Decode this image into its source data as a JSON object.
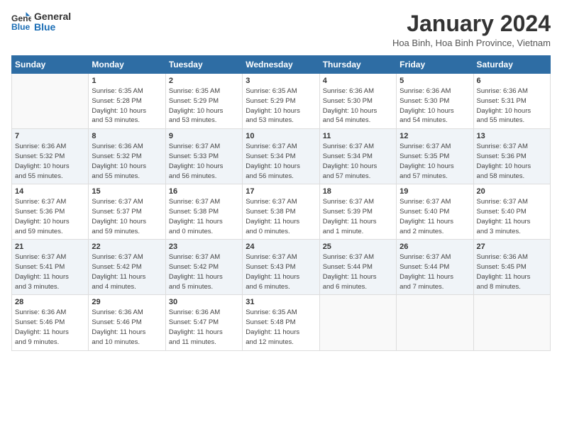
{
  "header": {
    "logo_line1": "General",
    "logo_line2": "Blue",
    "month_title": "January 2024",
    "location": "Hoa Binh, Hoa Binh Province, Vietnam"
  },
  "calendar": {
    "headers": [
      "Sunday",
      "Monday",
      "Tuesday",
      "Wednesday",
      "Thursday",
      "Friday",
      "Saturday"
    ],
    "weeks": [
      [
        {
          "day": "",
          "info": ""
        },
        {
          "day": "1",
          "info": "Sunrise: 6:35 AM\nSunset: 5:28 PM\nDaylight: 10 hours\nand 53 minutes."
        },
        {
          "day": "2",
          "info": "Sunrise: 6:35 AM\nSunset: 5:29 PM\nDaylight: 10 hours\nand 53 minutes."
        },
        {
          "day": "3",
          "info": "Sunrise: 6:35 AM\nSunset: 5:29 PM\nDaylight: 10 hours\nand 53 minutes."
        },
        {
          "day": "4",
          "info": "Sunrise: 6:36 AM\nSunset: 5:30 PM\nDaylight: 10 hours\nand 54 minutes."
        },
        {
          "day": "5",
          "info": "Sunrise: 6:36 AM\nSunset: 5:30 PM\nDaylight: 10 hours\nand 54 minutes."
        },
        {
          "day": "6",
          "info": "Sunrise: 6:36 AM\nSunset: 5:31 PM\nDaylight: 10 hours\nand 55 minutes."
        }
      ],
      [
        {
          "day": "7",
          "info": "Sunrise: 6:36 AM\nSunset: 5:32 PM\nDaylight: 10 hours\nand 55 minutes."
        },
        {
          "day": "8",
          "info": "Sunrise: 6:36 AM\nSunset: 5:32 PM\nDaylight: 10 hours\nand 55 minutes."
        },
        {
          "day": "9",
          "info": "Sunrise: 6:37 AM\nSunset: 5:33 PM\nDaylight: 10 hours\nand 56 minutes."
        },
        {
          "day": "10",
          "info": "Sunrise: 6:37 AM\nSunset: 5:34 PM\nDaylight: 10 hours\nand 56 minutes."
        },
        {
          "day": "11",
          "info": "Sunrise: 6:37 AM\nSunset: 5:34 PM\nDaylight: 10 hours\nand 57 minutes."
        },
        {
          "day": "12",
          "info": "Sunrise: 6:37 AM\nSunset: 5:35 PM\nDaylight: 10 hours\nand 57 minutes."
        },
        {
          "day": "13",
          "info": "Sunrise: 6:37 AM\nSunset: 5:36 PM\nDaylight: 10 hours\nand 58 minutes."
        }
      ],
      [
        {
          "day": "14",
          "info": "Sunrise: 6:37 AM\nSunset: 5:36 PM\nDaylight: 10 hours\nand 59 minutes."
        },
        {
          "day": "15",
          "info": "Sunrise: 6:37 AM\nSunset: 5:37 PM\nDaylight: 10 hours\nand 59 minutes."
        },
        {
          "day": "16",
          "info": "Sunrise: 6:37 AM\nSunset: 5:38 PM\nDaylight: 11 hours\nand 0 minutes."
        },
        {
          "day": "17",
          "info": "Sunrise: 6:37 AM\nSunset: 5:38 PM\nDaylight: 11 hours\nand 0 minutes."
        },
        {
          "day": "18",
          "info": "Sunrise: 6:37 AM\nSunset: 5:39 PM\nDaylight: 11 hours\nand 1 minute."
        },
        {
          "day": "19",
          "info": "Sunrise: 6:37 AM\nSunset: 5:40 PM\nDaylight: 11 hours\nand 2 minutes."
        },
        {
          "day": "20",
          "info": "Sunrise: 6:37 AM\nSunset: 5:40 PM\nDaylight: 11 hours\nand 3 minutes."
        }
      ],
      [
        {
          "day": "21",
          "info": "Sunrise: 6:37 AM\nSunset: 5:41 PM\nDaylight: 11 hours\nand 3 minutes."
        },
        {
          "day": "22",
          "info": "Sunrise: 6:37 AM\nSunset: 5:42 PM\nDaylight: 11 hours\nand 4 minutes."
        },
        {
          "day": "23",
          "info": "Sunrise: 6:37 AM\nSunset: 5:42 PM\nDaylight: 11 hours\nand 5 minutes."
        },
        {
          "day": "24",
          "info": "Sunrise: 6:37 AM\nSunset: 5:43 PM\nDaylight: 11 hours\nand 6 minutes."
        },
        {
          "day": "25",
          "info": "Sunrise: 6:37 AM\nSunset: 5:44 PM\nDaylight: 11 hours\nand 6 minutes."
        },
        {
          "day": "26",
          "info": "Sunrise: 6:37 AM\nSunset: 5:44 PM\nDaylight: 11 hours\nand 7 minutes."
        },
        {
          "day": "27",
          "info": "Sunrise: 6:36 AM\nSunset: 5:45 PM\nDaylight: 11 hours\nand 8 minutes."
        }
      ],
      [
        {
          "day": "28",
          "info": "Sunrise: 6:36 AM\nSunset: 5:46 PM\nDaylight: 11 hours\nand 9 minutes."
        },
        {
          "day": "29",
          "info": "Sunrise: 6:36 AM\nSunset: 5:46 PM\nDaylight: 11 hours\nand 10 minutes."
        },
        {
          "day": "30",
          "info": "Sunrise: 6:36 AM\nSunset: 5:47 PM\nDaylight: 11 hours\nand 11 minutes."
        },
        {
          "day": "31",
          "info": "Sunrise: 6:35 AM\nSunset: 5:48 PM\nDaylight: 11 hours\nand 12 minutes."
        },
        {
          "day": "",
          "info": ""
        },
        {
          "day": "",
          "info": ""
        },
        {
          "day": "",
          "info": ""
        }
      ]
    ]
  }
}
